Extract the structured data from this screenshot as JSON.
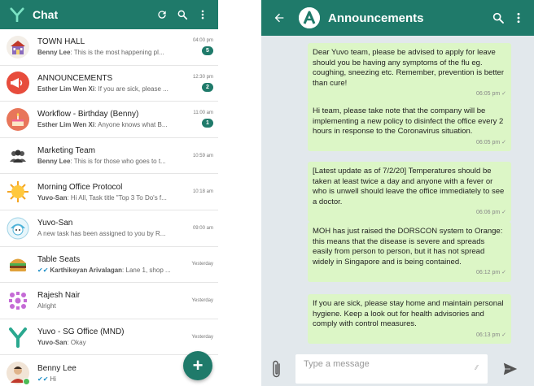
{
  "colors": {
    "primary": "#1f7a6a",
    "bubble": "#dcf6c6",
    "read_tick": "#1f8fc7",
    "online": "#4cbb55"
  },
  "left": {
    "title": "Chat",
    "icons": [
      "refresh-icon",
      "search-icon",
      "more-vert-icon"
    ],
    "chats": [
      {
        "name": "TOWN HALL",
        "sender": "Benny Lee",
        "message": "This is the most happening pl...",
        "time": "04:00 pm",
        "badge": "5",
        "avatar": "town-hall-avatar"
      },
      {
        "name": "ANNOUNCEMENTS",
        "sender": "Esther Lim Wen Xi",
        "message": "If you are sick, please ...",
        "time": "12:30 pm",
        "badge": "2",
        "avatar": "megaphone-avatar"
      },
      {
        "name": "Workflow - Birthday (Benny)",
        "sender": "Esther Lim Wen Xi",
        "message": "Anyone knows what B...",
        "time": "11:00 am",
        "badge": "1",
        "avatar": "birthday-cake-avatar"
      },
      {
        "name": "Marketing Team",
        "sender": "Benny Lee",
        "message": "This is for those who goes to t...",
        "time": "10:59 am",
        "badge": "",
        "avatar": "group-avatar"
      },
      {
        "name": "Morning Office Protocol",
        "sender": "Yuvo-San",
        "message": "Hi All, Task title \"Top 3 To Do's f...",
        "time": "10:18 am",
        "badge": "",
        "avatar": "sun-avatar"
      },
      {
        "name": "Yuvo-San",
        "sender": "",
        "message": "A new task has been assigned to you by R...",
        "time": "09:00 am",
        "badge": "",
        "avatar": "robot-avatar"
      },
      {
        "name": "Table Seats",
        "sender": "Karthikeyan Arivalagan",
        "message": "Lane 1, shop ...",
        "time": "Yesterday",
        "badge": "",
        "avatar": "burger-avatar",
        "ticked": true
      },
      {
        "name": "Rajesh Nair",
        "sender": "",
        "message": "Alright",
        "time": "Yesterday",
        "badge": "",
        "avatar": "pattern-avatar"
      },
      {
        "name": "Yuvo - SG Office (MND)",
        "sender": "Yuvo-San",
        "message": "Okay",
        "time": "Yesterday",
        "badge": "",
        "avatar": "yuvo-logo-avatar"
      },
      {
        "name": "Benny Lee",
        "sender": "",
        "message": "Hi",
        "time": "",
        "badge": "",
        "avatar": "person-avatar",
        "ticked": true,
        "online": true
      }
    ],
    "fab_label": "+"
  },
  "right": {
    "title": "Announcements",
    "messages": [
      {
        "text": "Dear Yuvo team, please be advised to apply for leave should you be having any symptoms of the flu eg. coughing, sneezing etc. Remember, prevention is better than cure!",
        "time": "06:05 pm"
      },
      {
        "text": "Hi team, please take note that the company will be implementing a new policy to disinfect the office every 2 hours in response to the Coronavirus situation.",
        "time": "06:05 pm"
      },
      {
        "text": "[Latest update as of 7/2/20] Temperatures should be taken at least twice a day and anyone with a fever or who is unwell should leave the office immediately to see a doctor.",
        "time": "06:06 pm"
      },
      {
        "text": "MOH has just raised the DORSCON system to Orange: this means that the disease is severe and spreads easily from person to person, but it has not spread widely in Singapore and is being contained.",
        "time": "06:12 pm"
      },
      {
        "text": "If you are sick, please stay home and maintain personal hygiene. Keep a look out for health advisories and comply with control measures.",
        "time": "06:13 pm"
      }
    ],
    "composer": {
      "placeholder": "Type a message"
    }
  }
}
